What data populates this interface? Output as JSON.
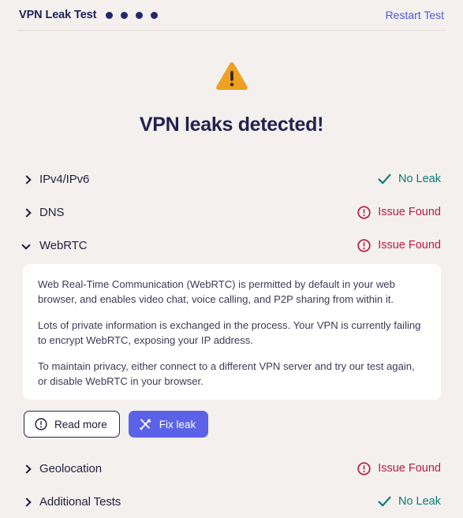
{
  "header": {
    "title": "VPN Leak Test",
    "dots_count": 4,
    "restart_label": "Restart Test"
  },
  "hero": {
    "icon": "warning-triangle-icon",
    "title": "VPN leaks detected!"
  },
  "colors": {
    "background": "#f4f0ee",
    "navy": "#22224e",
    "accent_purple": "#5b62e8",
    "link_blue": "#4e57d6",
    "ok_teal": "#0d7b74",
    "bad_crimson": "#b9184a",
    "warning_amber": "#eda022",
    "panel_white": "#ffffff"
  },
  "status_labels": {
    "no_leak": "No Leak",
    "issue_found": "Issue Found"
  },
  "tests": [
    {
      "id": "ipv4-ipv6",
      "label": "IPv4/IPv6",
      "status": "No Leak",
      "state": "ok",
      "expanded": false,
      "chevron": "chevron-right-icon",
      "status_icon": "check-icon"
    },
    {
      "id": "dns",
      "label": "DNS",
      "status": "Issue Found",
      "state": "bad",
      "expanded": false,
      "chevron": "chevron-right-icon",
      "status_icon": "exclamation-circle-icon"
    },
    {
      "id": "webrtc",
      "label": "WebRTC",
      "status": "Issue Found",
      "state": "bad",
      "expanded": true,
      "chevron": "chevron-down-icon",
      "status_icon": "exclamation-circle-icon"
    },
    {
      "id": "geolocation",
      "label": "Geolocation",
      "status": "Issue Found",
      "state": "bad",
      "expanded": false,
      "chevron": "chevron-right-icon",
      "status_icon": "exclamation-circle-icon"
    },
    {
      "id": "additional-tests",
      "label": "Additional Tests",
      "status": "No Leak",
      "state": "ok",
      "expanded": false,
      "chevron": "chevron-right-icon",
      "status_icon": "check-icon"
    }
  ],
  "webrtc_panel": {
    "paragraph1": "Web Real-Time Communication (WebRTC) is permitted by default in your web browser, and enables video chat, voice calling, and P2P sharing from within it.",
    "paragraph2": "Lots of private information is exchanged in the process. Your VPN is currently failing to encrypt WebRTC, exposing your IP address.",
    "paragraph3": "To maintain privacy, either connect to a different VPN server and try our test again, or disable WebRTC in your browser.",
    "read_more_label": "Read more",
    "read_more_icon": "exclamation-circle-icon",
    "fix_leak_label": "Fix leak",
    "fix_leak_icon": "hammer-wrench-icon"
  }
}
